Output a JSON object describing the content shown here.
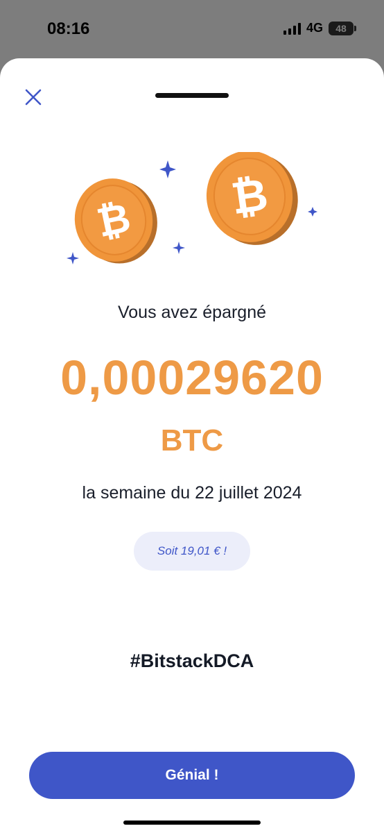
{
  "status_bar": {
    "time": "08:16",
    "network": "4G",
    "battery": "48"
  },
  "sheet": {
    "close_icon": "close-icon",
    "saved_heading": "Vous avez épargné",
    "amount": "0,00029620",
    "unit": "BTC",
    "week_label": "la semaine du 22 juillet 2024",
    "equivalent": "Soit 19,01 € !",
    "hashtag": "#BitstackDCA",
    "cta_label": "Génial !"
  },
  "colors": {
    "accent": "#3f56c8",
    "bitcoin_orange": "#ee9a46",
    "badge_bg": "#eceefa",
    "text_dark": "#1a1f2b"
  }
}
